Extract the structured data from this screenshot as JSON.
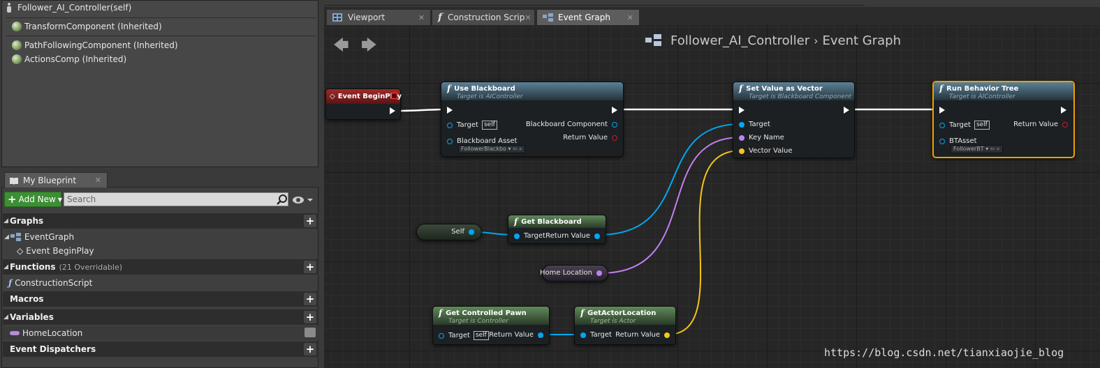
{
  "components": {
    "root": "Follower_AI_Controller(self)",
    "items": [
      "TransformComponent (Inherited)",
      "PathFollowingComponent (Inherited)",
      "ActionsComp (Inherited)"
    ]
  },
  "my_blueprint": {
    "tab_label": "My Blueprint",
    "add_new_label": "Add New",
    "search_placeholder": "Search",
    "sections": {
      "graphs": "Graphs",
      "functions": "Functions",
      "functions_sub": "(21 Overridable)",
      "macros": "Macros",
      "variables": "Variables",
      "dispatchers": "Event Dispatchers"
    },
    "graph_items": [
      "EventGraph",
      "Event BeginPlay"
    ],
    "function_items": [
      "ConstructionScript"
    ],
    "variable_items": [
      "HomeLocation"
    ]
  },
  "doc_tabs": [
    "Viewport",
    "Construction Scrip",
    "Event Graph"
  ],
  "breadcrumb": {
    "blueprint": "Follower_AI_Controller",
    "graph": "Event Graph"
  },
  "nodes": {
    "begin_play": {
      "title": "Event BeginPlay"
    },
    "use_blackboard": {
      "title": "Use Blackboard",
      "subtitle": "Target is AIController",
      "target": "Target",
      "self": "self",
      "asset": "Blackboard Asset",
      "asset_value": "FollowerBlackbo",
      "out1": "Blackboard Component",
      "out2": "Return Value"
    },
    "set_value": {
      "title": "Set Value as Vector",
      "subtitle": "Target is Blackboard Component",
      "p1": "Target",
      "p2": "Key Name",
      "p3": "Vector Value"
    },
    "run_bt": {
      "title": "Run Behavior Tree",
      "subtitle": "Target is AIController",
      "target": "Target",
      "self": "self",
      "asset": "BTAsset",
      "asset_value": "FollowerBT",
      "ret": "Return Value"
    },
    "self_node": {
      "label": "Self"
    },
    "get_blackboard": {
      "title": "Get Blackboard",
      "target": "Target",
      "ret": "Return Value"
    },
    "home_location": {
      "label": "Home Location"
    },
    "get_pawn": {
      "title": "Get Controlled Pawn",
      "subtitle": "Target is Controller",
      "target": "Target",
      "self": "self",
      "ret": "Return Value"
    },
    "get_loc": {
      "title": "GetActorLocation",
      "subtitle": "Target is Actor",
      "target": "Target",
      "ret": "Return Value"
    }
  },
  "watermark": "https://blog.csdn.net/tianxiaojie_blog",
  "colors": {
    "object_pin": "#00a8f4",
    "name_pin": "#c080f0",
    "vector_pin": "#f5c518",
    "exec": "#ffffff",
    "selected": "#f0a000"
  }
}
